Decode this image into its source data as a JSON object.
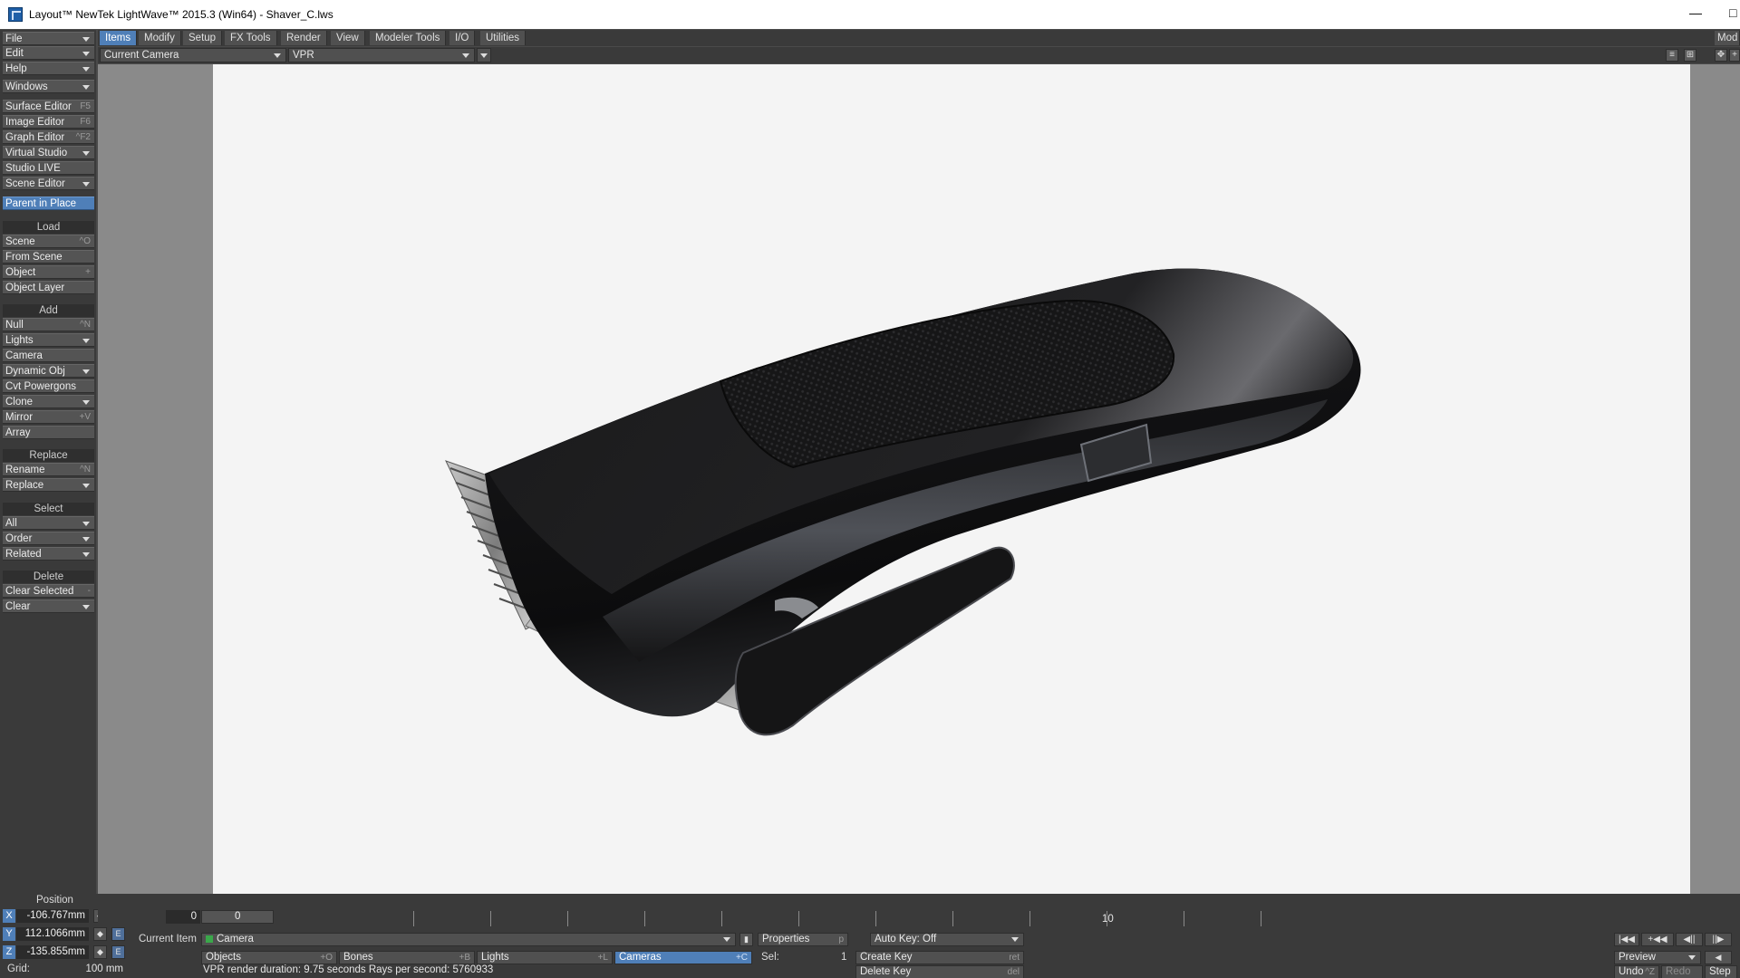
{
  "window": {
    "title": "Layout™ NewTek LightWave™ 2015.3 (Win64) - Shaver_C.lws",
    "minimize": "—",
    "restore": "□"
  },
  "left_toolbar": {
    "file": "File",
    "edit": "Edit",
    "help": "Help",
    "windows": "Windows",
    "surface_editor": "Surface Editor",
    "surface_editor_sc": "F5",
    "image_editor": "Image Editor",
    "image_editor_sc": "F6",
    "graph_editor": "Graph Editor",
    "graph_editor_sc": "^F2",
    "virtual_studio": "Virtual Studio",
    "studio_live": "Studio LIVE",
    "scene_editor": "Scene Editor",
    "parent_in_place": "Parent in Place",
    "load_header": "Load",
    "scene": "Scene",
    "scene_sc": "^O",
    "from_scene": "From Scene",
    "object": "Object",
    "object_sc": "+",
    "object_layer": "Object Layer",
    "add_header": "Add",
    "null": "Null",
    "null_sc": "^N",
    "lights": "Lights",
    "camera": "Camera",
    "dynamic_obj": "Dynamic Obj",
    "cvt_powergons": "Cvt Powergons",
    "clone": "Clone",
    "mirror": "Mirror",
    "mirror_sc": "+V",
    "array": "Array",
    "replace_header": "Replace",
    "rename": "Rename",
    "rename_sc": "^N",
    "replace": "Replace",
    "select_header": "Select",
    "all": "All",
    "order": "Order",
    "related": "Related",
    "delete_header": "Delete",
    "clear_selected": "Clear Selected",
    "clear_selected_sc": "-",
    "clear": "Clear"
  },
  "menu_tabs": [
    "Items",
    "Modify",
    "Setup",
    "FX Tools",
    "Render",
    "View",
    "Modeler Tools",
    "I/O",
    "Utilities"
  ],
  "modeler_tab": "Mod",
  "viewport": {
    "view_select": "Current Camera",
    "render_mode": "VPR"
  },
  "bottom": {
    "position_label": "Position",
    "x_label": "X",
    "x_value": "-106.767mm",
    "y_label": "Y",
    "y_value": "112.1066mm",
    "z_label": "Z",
    "z_value": "-135.855mm",
    "e_label": "E",
    "grid_label": "Grid:",
    "grid_value": "100 mm",
    "frame_start": "0",
    "frame_current": "0",
    "tick_10": "10",
    "current_item_label": "Current Item",
    "current_item": "Camera",
    "objects": "Objects",
    "objects_sc": "+O",
    "bones": "Bones",
    "bones_sc": "+B",
    "lights": "Lights",
    "lights_sc": "+L",
    "cameras": "Cameras",
    "cameras_sc": "+C",
    "properties": "Properties",
    "properties_sc": "p",
    "sel_label": "Sel:",
    "sel_value": "1",
    "auto_key": "Auto Key: Off",
    "create_key": "Create Key",
    "create_key_sc": "ret",
    "delete_key": "Delete Key",
    "delete_key_sc": "del",
    "status": "VPR render duration: 9.75 seconds  Rays per second: 5760933",
    "preview": "Preview",
    "undo": "Undo",
    "undo_sc": "^Z",
    "redo": "Redo",
    "step": "Step"
  }
}
